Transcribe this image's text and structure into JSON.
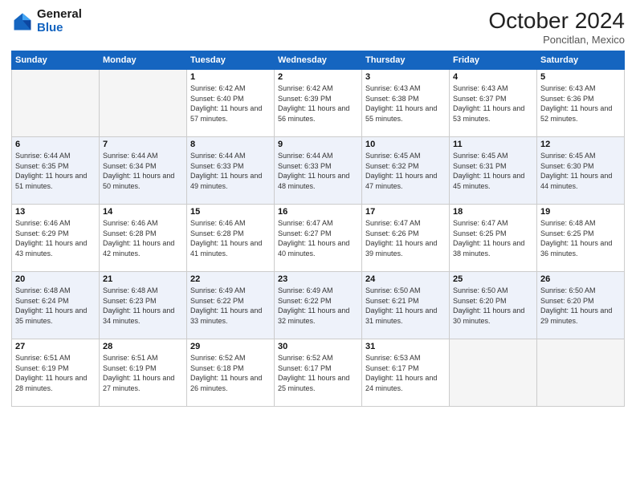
{
  "logo": {
    "line1": "General",
    "line2": "Blue"
  },
  "title": "October 2024",
  "location": "Poncitlan, Mexico",
  "weekdays": [
    "Sunday",
    "Monday",
    "Tuesday",
    "Wednesday",
    "Thursday",
    "Friday",
    "Saturday"
  ],
  "weeks": [
    [
      {
        "day": "",
        "info": ""
      },
      {
        "day": "",
        "info": ""
      },
      {
        "day": "1",
        "info": "Sunrise: 6:42 AM\nSunset: 6:40 PM\nDaylight: 11 hours and 57 minutes."
      },
      {
        "day": "2",
        "info": "Sunrise: 6:42 AM\nSunset: 6:39 PM\nDaylight: 11 hours and 56 minutes."
      },
      {
        "day": "3",
        "info": "Sunrise: 6:43 AM\nSunset: 6:38 PM\nDaylight: 11 hours and 55 minutes."
      },
      {
        "day": "4",
        "info": "Sunrise: 6:43 AM\nSunset: 6:37 PM\nDaylight: 11 hours and 53 minutes."
      },
      {
        "day": "5",
        "info": "Sunrise: 6:43 AM\nSunset: 6:36 PM\nDaylight: 11 hours and 52 minutes."
      }
    ],
    [
      {
        "day": "6",
        "info": "Sunrise: 6:44 AM\nSunset: 6:35 PM\nDaylight: 11 hours and 51 minutes."
      },
      {
        "day": "7",
        "info": "Sunrise: 6:44 AM\nSunset: 6:34 PM\nDaylight: 11 hours and 50 minutes."
      },
      {
        "day": "8",
        "info": "Sunrise: 6:44 AM\nSunset: 6:33 PM\nDaylight: 11 hours and 49 minutes."
      },
      {
        "day": "9",
        "info": "Sunrise: 6:44 AM\nSunset: 6:33 PM\nDaylight: 11 hours and 48 minutes."
      },
      {
        "day": "10",
        "info": "Sunrise: 6:45 AM\nSunset: 6:32 PM\nDaylight: 11 hours and 47 minutes."
      },
      {
        "day": "11",
        "info": "Sunrise: 6:45 AM\nSunset: 6:31 PM\nDaylight: 11 hours and 45 minutes."
      },
      {
        "day": "12",
        "info": "Sunrise: 6:45 AM\nSunset: 6:30 PM\nDaylight: 11 hours and 44 minutes."
      }
    ],
    [
      {
        "day": "13",
        "info": "Sunrise: 6:46 AM\nSunset: 6:29 PM\nDaylight: 11 hours and 43 minutes."
      },
      {
        "day": "14",
        "info": "Sunrise: 6:46 AM\nSunset: 6:28 PM\nDaylight: 11 hours and 42 minutes."
      },
      {
        "day": "15",
        "info": "Sunrise: 6:46 AM\nSunset: 6:28 PM\nDaylight: 11 hours and 41 minutes."
      },
      {
        "day": "16",
        "info": "Sunrise: 6:47 AM\nSunset: 6:27 PM\nDaylight: 11 hours and 40 minutes."
      },
      {
        "day": "17",
        "info": "Sunrise: 6:47 AM\nSunset: 6:26 PM\nDaylight: 11 hours and 39 minutes."
      },
      {
        "day": "18",
        "info": "Sunrise: 6:47 AM\nSunset: 6:25 PM\nDaylight: 11 hours and 38 minutes."
      },
      {
        "day": "19",
        "info": "Sunrise: 6:48 AM\nSunset: 6:25 PM\nDaylight: 11 hours and 36 minutes."
      }
    ],
    [
      {
        "day": "20",
        "info": "Sunrise: 6:48 AM\nSunset: 6:24 PM\nDaylight: 11 hours and 35 minutes."
      },
      {
        "day": "21",
        "info": "Sunrise: 6:48 AM\nSunset: 6:23 PM\nDaylight: 11 hours and 34 minutes."
      },
      {
        "day": "22",
        "info": "Sunrise: 6:49 AM\nSunset: 6:22 PM\nDaylight: 11 hours and 33 minutes."
      },
      {
        "day": "23",
        "info": "Sunrise: 6:49 AM\nSunset: 6:22 PM\nDaylight: 11 hours and 32 minutes."
      },
      {
        "day": "24",
        "info": "Sunrise: 6:50 AM\nSunset: 6:21 PM\nDaylight: 11 hours and 31 minutes."
      },
      {
        "day": "25",
        "info": "Sunrise: 6:50 AM\nSunset: 6:20 PM\nDaylight: 11 hours and 30 minutes."
      },
      {
        "day": "26",
        "info": "Sunrise: 6:50 AM\nSunset: 6:20 PM\nDaylight: 11 hours and 29 minutes."
      }
    ],
    [
      {
        "day": "27",
        "info": "Sunrise: 6:51 AM\nSunset: 6:19 PM\nDaylight: 11 hours and 28 minutes."
      },
      {
        "day": "28",
        "info": "Sunrise: 6:51 AM\nSunset: 6:19 PM\nDaylight: 11 hours and 27 minutes."
      },
      {
        "day": "29",
        "info": "Sunrise: 6:52 AM\nSunset: 6:18 PM\nDaylight: 11 hours and 26 minutes."
      },
      {
        "day": "30",
        "info": "Sunrise: 6:52 AM\nSunset: 6:17 PM\nDaylight: 11 hours and 25 minutes."
      },
      {
        "day": "31",
        "info": "Sunrise: 6:53 AM\nSunset: 6:17 PM\nDaylight: 11 hours and 24 minutes."
      },
      {
        "day": "",
        "info": ""
      },
      {
        "day": "",
        "info": ""
      }
    ]
  ]
}
